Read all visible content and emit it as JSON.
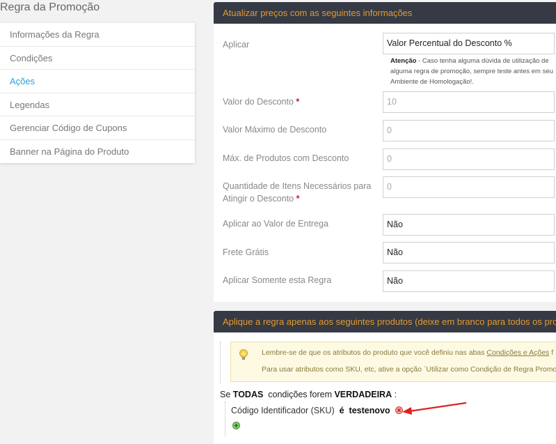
{
  "sidebar": {
    "title": "Regra da Promoção",
    "items": [
      {
        "label": "Informações da Regra"
      },
      {
        "label": "Condições"
      },
      {
        "label": "Ações"
      },
      {
        "label": "Legendas"
      },
      {
        "label": "Gerenciar Código de Cupons"
      },
      {
        "label": "Banner na Página do Produto"
      }
    ],
    "active_index": 2,
    "active_color": "#2aa3d6"
  },
  "actions_panel": {
    "header": "Atualizar preços com as seguintes informações",
    "header_bg": "#353a45",
    "header_color": "#e59a2f",
    "apply": {
      "label": "Aplicar",
      "value": "Valor Percentual do Desconto %",
      "note_bold": "Atenção",
      "note_text": " - Caso tenha alguma dúvida de utilização de alguma regra de promoção, sempre teste antes em seu Ambiente de Homologação!."
    },
    "discount_amount": {
      "label": "Valor do Desconto",
      "required": "*",
      "value": "10"
    },
    "max_discount": {
      "label": "Valor Máximo de Desconto",
      "value": "0"
    },
    "max_products": {
      "label": "Máx. de Produtos com Desconto",
      "value": "0"
    },
    "qty_required": {
      "label": "Quantidade de Itens Necessários para Atingir o Desconto",
      "required": "*",
      "value": "0"
    },
    "apply_shipping": {
      "label": "Aplicar ao Valor de Entrega",
      "value": "Não"
    },
    "free_shipping": {
      "label": "Frete Grátis",
      "value": "Não"
    },
    "stop_rules": {
      "label": "Aplicar Somente esta Regra",
      "value": "Não"
    }
  },
  "conditions_panel": {
    "header": "Aplique a regra apenas aos seguintes produtos (deixe em branco para todos os produtos)",
    "info_line1_a": "Lembre-se de que os atributos do produto que você definiu nas abas ",
    "info_line1_link": "Condições e Ações",
    "info_line1_b": " f",
    "info_line2": "Para usar atributos como SKU, etc, ative a opção `Utilizar como Condição de Regra Promo",
    "cond_if": "Se",
    "cond_all": "TODAS",
    "cond_mid": "condições forem",
    "cond_true": "VERDADEIRA",
    "cond_colon": ":",
    "sku_label": "Código Identificador (SKU)",
    "sku_op": "é",
    "sku_value": "testenovo",
    "icons": {
      "bulb": "lightbulb-icon",
      "remove": "remove-condition-icon",
      "add": "add-condition-icon",
      "arrow": "arrow-annotation"
    },
    "arrow_color": "#e02020"
  }
}
